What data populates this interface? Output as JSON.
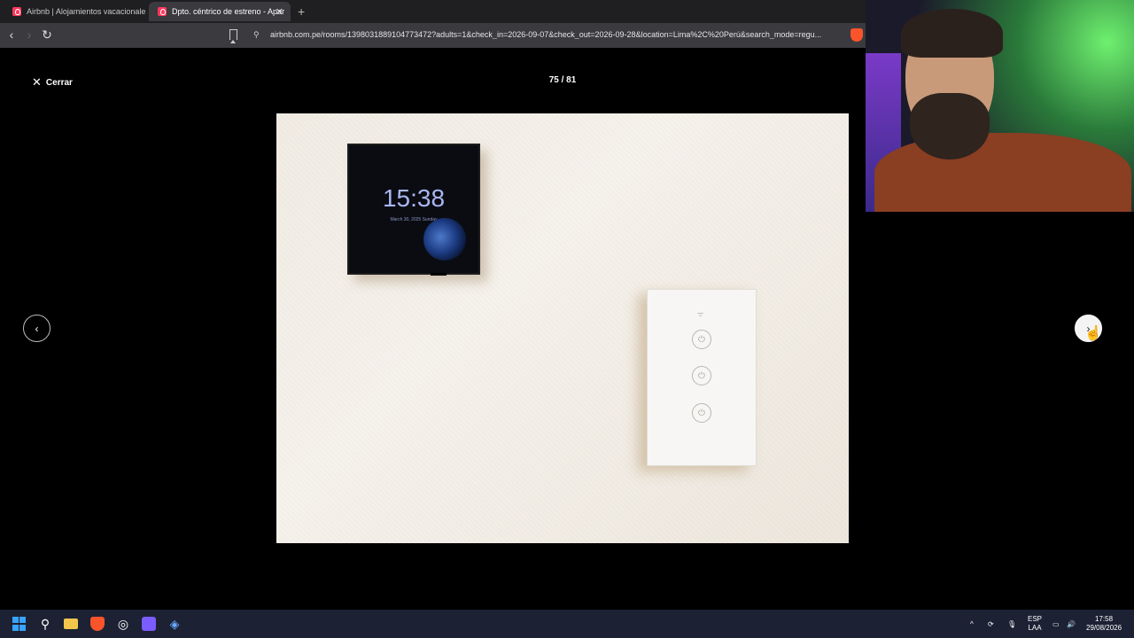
{
  "browser": {
    "tabs": [
      {
        "title": "Airbnb | Alojamientos vacacionales y",
        "active": false
      },
      {
        "title": "Dpto. céntrico de estreno - Apar",
        "active": true
      }
    ],
    "tab_close_glyph": "✕",
    "new_tab_glyph": "+",
    "url": "airbnb.com.pe/rooms/1398031889104773472?adults=1&check_in=2026-09-07&check_out=2026-09-28&location=Lima%2C%20Perú&search_mode=regu...",
    "back_glyph": "‹",
    "forward_glyph": "›",
    "reload_glyph": "↻",
    "site_info_glyph": "⚲"
  },
  "lightbox": {
    "close_label": "Cerrar",
    "close_glyph": "✕",
    "counter": "75 / 81",
    "prev_glyph": "‹",
    "next_glyph": "›"
  },
  "photo": {
    "clock_time": "15:38",
    "clock_date": "March 30, 2025 Sunday",
    "wifi_glyph": "ᯤ",
    "power_glyph": "⏻"
  },
  "taskbar": {
    "language_top": "ESP",
    "language_bottom": "LAA",
    "time": "17:58",
    "date": "29/08/2026",
    "tray_glyphs": [
      "^",
      "⟳",
      "🎙",
      "▭",
      "🔊"
    ]
  },
  "colors": {
    "airbnb": "#ff385c",
    "brave": "#fb542b",
    "background": "#000000"
  }
}
